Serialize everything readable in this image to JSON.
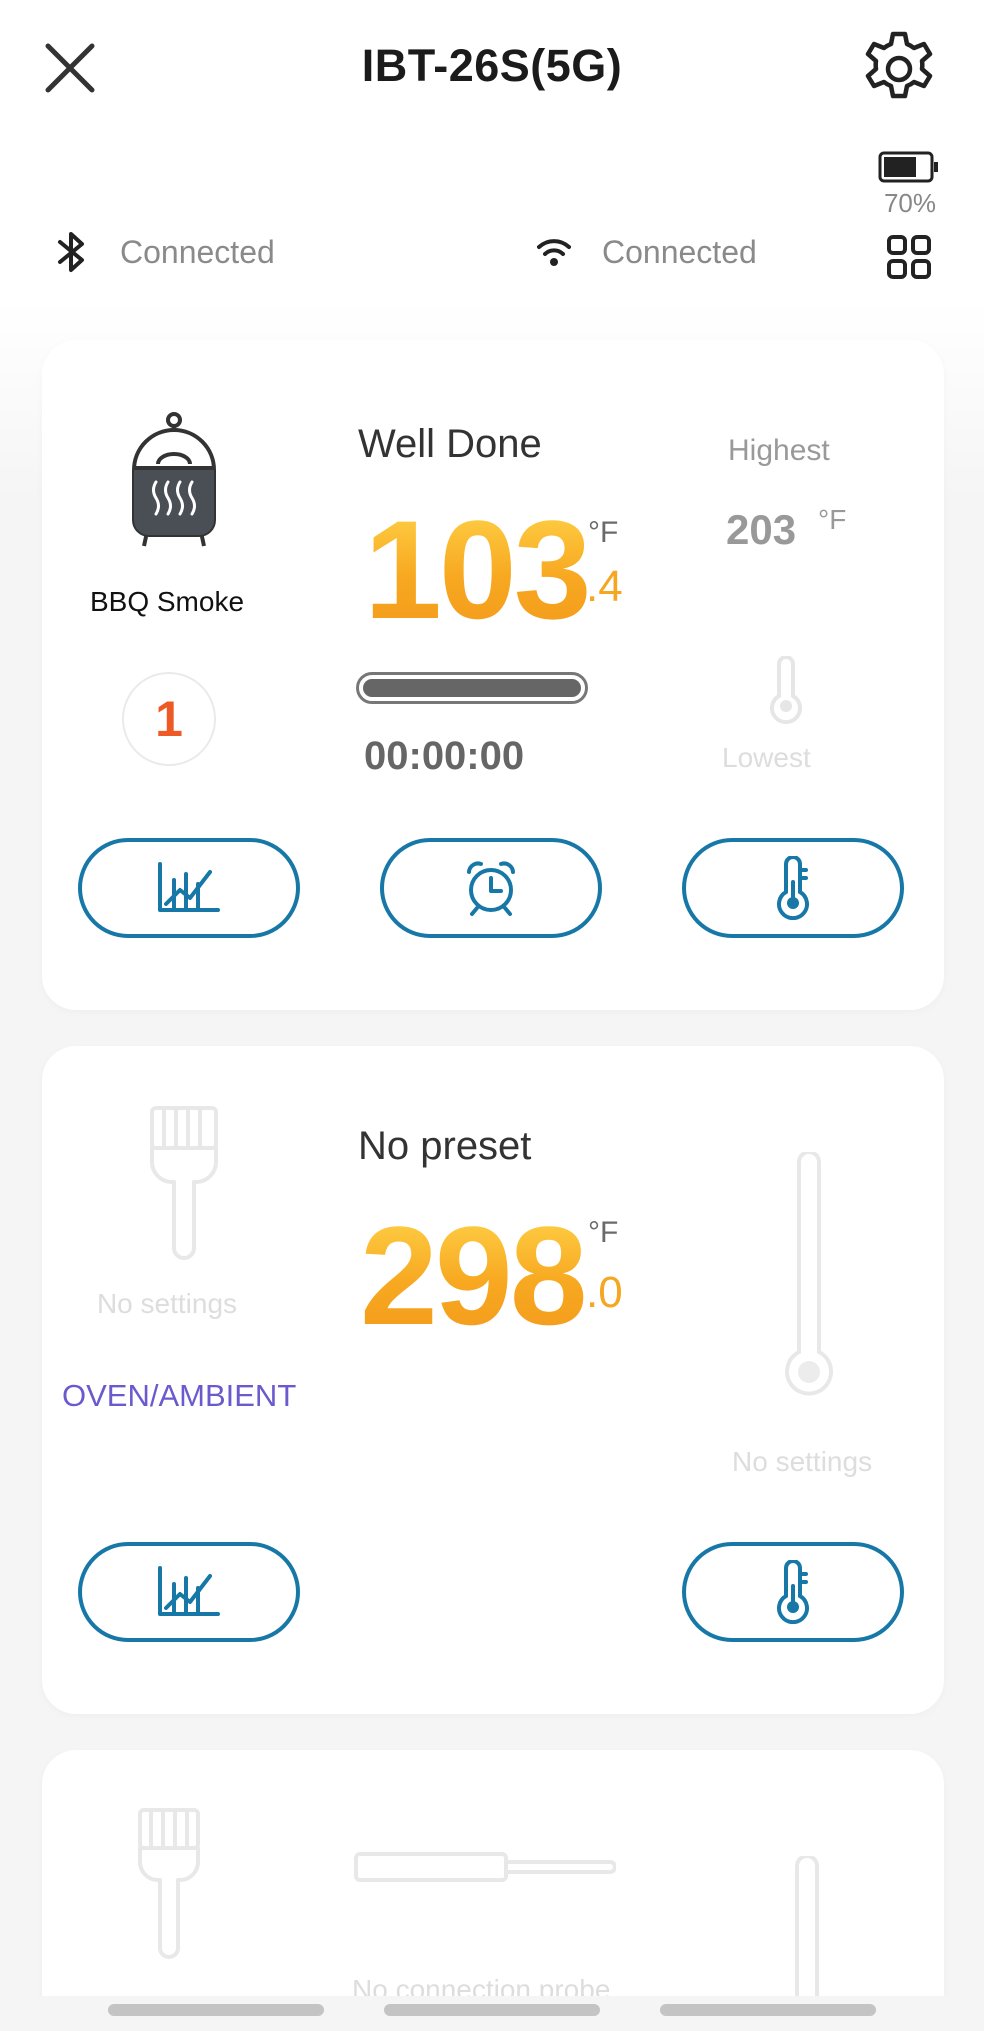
{
  "header": {
    "title": "IBT-26S(5G)",
    "battery_percent": "70%"
  },
  "status": {
    "bluetooth": "Connected",
    "wifi": "Connected"
  },
  "probe1": {
    "preset_icon": "bbq-smoke-icon",
    "preset_name": "BBQ Smoke",
    "probe_number": "1",
    "doneness": "Well Done",
    "temp_int": "103",
    "temp_dec": ".4",
    "unit": "°F",
    "highest_label": "Highest",
    "highest_value": "203",
    "highest_unit": "°F",
    "lowest_label": "Lowest",
    "timer": "00:00:00",
    "buttons": [
      "chart-icon",
      "alarm-clock-icon",
      "thermometer-icon"
    ]
  },
  "probe2": {
    "preset_name": "No preset",
    "left_status": "No settings",
    "channel_label": "OVEN/AMBIENT",
    "temp_int": "298",
    "temp_dec": ".0",
    "unit": "°F",
    "right_status": "No settings",
    "buttons": [
      "chart-icon",
      "thermometer-icon"
    ]
  },
  "probe3": {
    "status": "No connection probe"
  },
  "colors": {
    "accent_blue": "#1778a8",
    "temp_orange": "#f5a623",
    "probe_number_red": "#ee5a26",
    "channel_purple": "#6a5acd"
  }
}
